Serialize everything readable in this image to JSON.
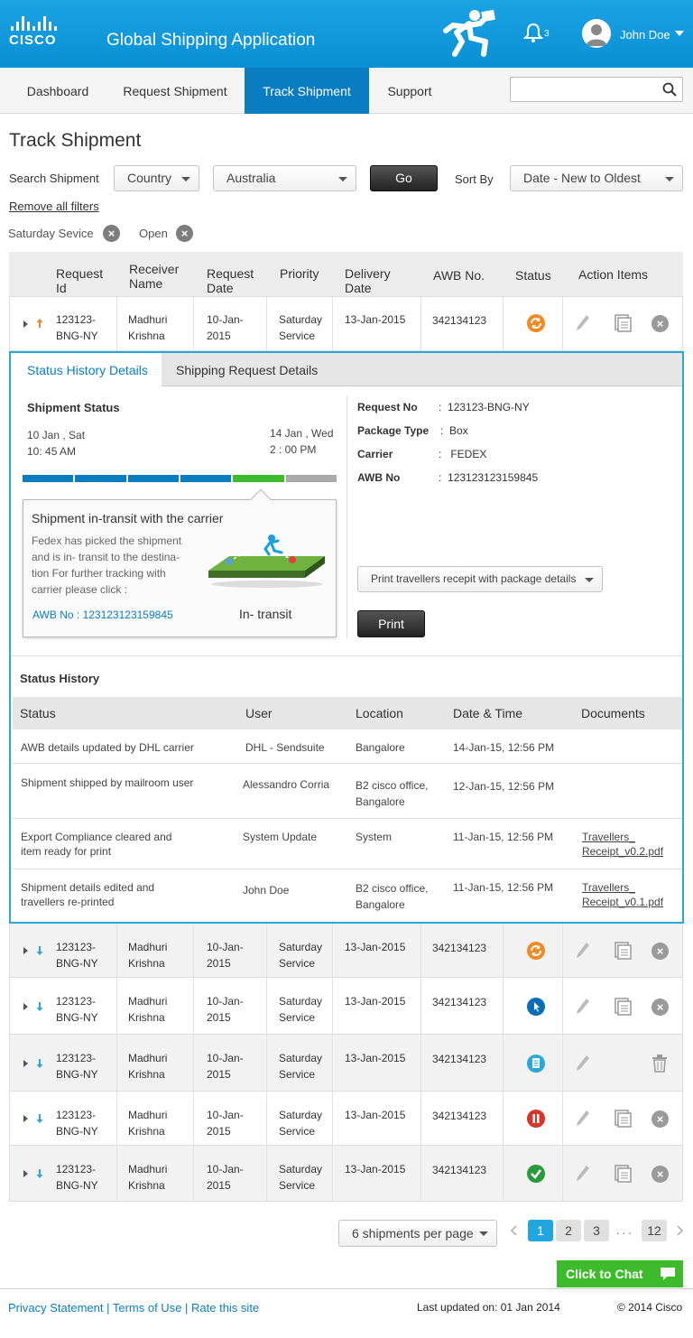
{
  "header": {
    "logo_text": "CISCO",
    "app_title": "Global Shipping Application",
    "notification_count": "3",
    "user_name": "John Doe"
  },
  "nav": {
    "tabs": [
      {
        "label": "Dashboard"
      },
      {
        "label": "Request Shipment"
      },
      {
        "label": "Track Shipment",
        "active": true
      },
      {
        "label": "Support"
      }
    ],
    "search_placeholder": ""
  },
  "page": {
    "title": "Track Shipment",
    "search_label": "Search Shipment",
    "filter_field": "Country",
    "filter_value": "Australia",
    "go_label": "Go",
    "sort_label": "Sort By",
    "sort_value": "Date - New to Oldest",
    "remove_filters": "Remove all filters",
    "chips": [
      "Saturday Sevice",
      "Open"
    ]
  },
  "table": {
    "headers": {
      "request_id": "Request Id",
      "receiver": "Receiver Name",
      "request_date": "Request Date",
      "priority": "Priority",
      "delivery": "Delivery Date",
      "awb": "AWB No.",
      "status": "Status",
      "actions": "Action Items"
    },
    "rows": [
      {
        "id1": "123123-",
        "id2": "BNG-NY",
        "name1": "Madhuri",
        "name2": "Krishna",
        "date1": "10-Jan-",
        "date2": "2015",
        "pri1": "Saturday",
        "pri2": "Service",
        "delivery": "13-Jan-2015",
        "awb": "342134123",
        "status": "in-progress",
        "expanded": true
      },
      {
        "id1": "123123-",
        "id2": "BNG-NY",
        "name1": "Madhuri",
        "name2": "Krishna",
        "date1": "10-Jan-",
        "date2": "2015",
        "pri1": "Saturday",
        "pri2": "Service",
        "delivery": "13-Jan-2015",
        "awb": "342134123",
        "status": "in-progress"
      },
      {
        "id1": "123123-",
        "id2": "BNG-NY",
        "name1": "Madhuri",
        "name2": "Krishna",
        "date1": "10-Jan-",
        "date2": "2015",
        "pri1": "Saturday",
        "pri2": "Service",
        "delivery": "13-Jan-2015",
        "awb": "342134123",
        "status": "picked"
      },
      {
        "id1": "123123-",
        "id2": "BNG-NY",
        "name1": "Madhuri",
        "name2": "Krishna",
        "date1": "10-Jan-",
        "date2": "2015",
        "pri1": "Saturday",
        "pri2": "Service",
        "delivery": "13-Jan-2015",
        "awb": "342134123",
        "status": "draft"
      },
      {
        "id1": "123123-",
        "id2": "BNG-NY",
        "name1": "Madhuri",
        "name2": "Krishna",
        "date1": "10-Jan-",
        "date2": "2015",
        "pri1": "Saturday",
        "pri2": "Service",
        "delivery": "13-Jan-2015",
        "awb": "342134123",
        "status": "on-hold"
      },
      {
        "id1": "123123-",
        "id2": "BNG-NY",
        "name1": "Madhuri",
        "name2": "Krishna",
        "date1": "10-Jan-",
        "date2": "2015",
        "pri1": "Saturday",
        "pri2": "Service",
        "delivery": "13-Jan-2015",
        "awb": "342134123",
        "status": "delivered"
      }
    ]
  },
  "detail": {
    "tab_active": "Status History Details",
    "tab_other": "Shipping Request Details",
    "shipment_status_title": "Shipment Status",
    "start_date": "10 Jan , Sat",
    "start_time": "10: 45 AM",
    "end_date": "14  Jan , Wed",
    "end_time": "2 : 00 PM",
    "progress_segments_done": 4,
    "progress_segments_current": 1,
    "progress_segments_total": 6,
    "card_title": "Shipment in-transit with the carrier",
    "card_text": [
      "Fedex has picked the shipment",
      "and is in- transit to the destina-",
      "tion For further tracking with",
      "carrier please click  :"
    ],
    "card_link": "AWB No : 123123123159845",
    "card_state": "In- transit",
    "info": [
      {
        "k": "Request No",
        "v": "123123-BNG-NY"
      },
      {
        "k": "Package Type",
        "v": "Box"
      },
      {
        "k": "Carrier",
        "v": "FEDEX"
      },
      {
        "k": "AWB No",
        "v": "123123123159845"
      }
    ],
    "print_select": "Print travellers recepit with package details",
    "print_label": "Print",
    "history_title": "Status History",
    "history_headers": {
      "status": "Status",
      "user": "User",
      "location": "Location",
      "datetime": "Date & Time",
      "documents": "Documents"
    },
    "history": [
      {
        "status1": "AWB details updated by DHL carrier",
        "status2": "",
        "user": "DHL - Sendsuite",
        "loc1": "Bangalore",
        "loc2": "",
        "dt": "14-Jan-15, 12:56 PM",
        "doc1": "",
        "doc2": ""
      },
      {
        "status1": "Shipment shipped by mailroom user",
        "status2": "",
        "user": "Alessandro Corria",
        "loc1": "B2 cisco office,",
        "loc2": "Bangalore",
        "dt": "12-Jan-15, 12:56 PM",
        "doc1": "",
        "doc2": ""
      },
      {
        "status1": "Export Compliance cleared and",
        "status2": "item ready for print",
        "user": "System Update",
        "loc1": "System",
        "loc2": "",
        "dt": "11-Jan-15, 12:56 PM",
        "doc1": "Travellers_",
        "doc2": "Receipt_v0.2.pdf"
      },
      {
        "status1": "Shipment details edited and",
        "status2": "travellers re-printed",
        "user": "John Doe",
        "loc1": "B2 cisco office,",
        "loc2": "Bangalore",
        "dt": "11-Jan-15, 12:56 PM",
        "doc1": "Travellers_",
        "doc2": "Receipt_v0.1.pdf"
      }
    ]
  },
  "pagination": {
    "per_page": "6 shipments per page",
    "pages": [
      "1",
      "2",
      "3"
    ],
    "ellipsis": ". . .",
    "last": "12",
    "current": "1"
  },
  "chat_label": "Click to Chat",
  "footer": {
    "links": "Privacy Statement | Terms of Use | Rate this site",
    "updated": "Last updated on: 01 Jan 2014",
    "copyright": "© 2014 Cisco"
  },
  "colors": {
    "brand_blue": "#0a7dc2",
    "header_blue": "#1aa4e4",
    "panel_border": "#2ba7d8",
    "status_orange": "#f08a24",
    "status_red": "#d9342b",
    "status_green": "#2a9a3a",
    "progress_blue": "#0a7dc2",
    "progress_green": "#3ebb2d",
    "chat_green": "#3ebb2d"
  }
}
